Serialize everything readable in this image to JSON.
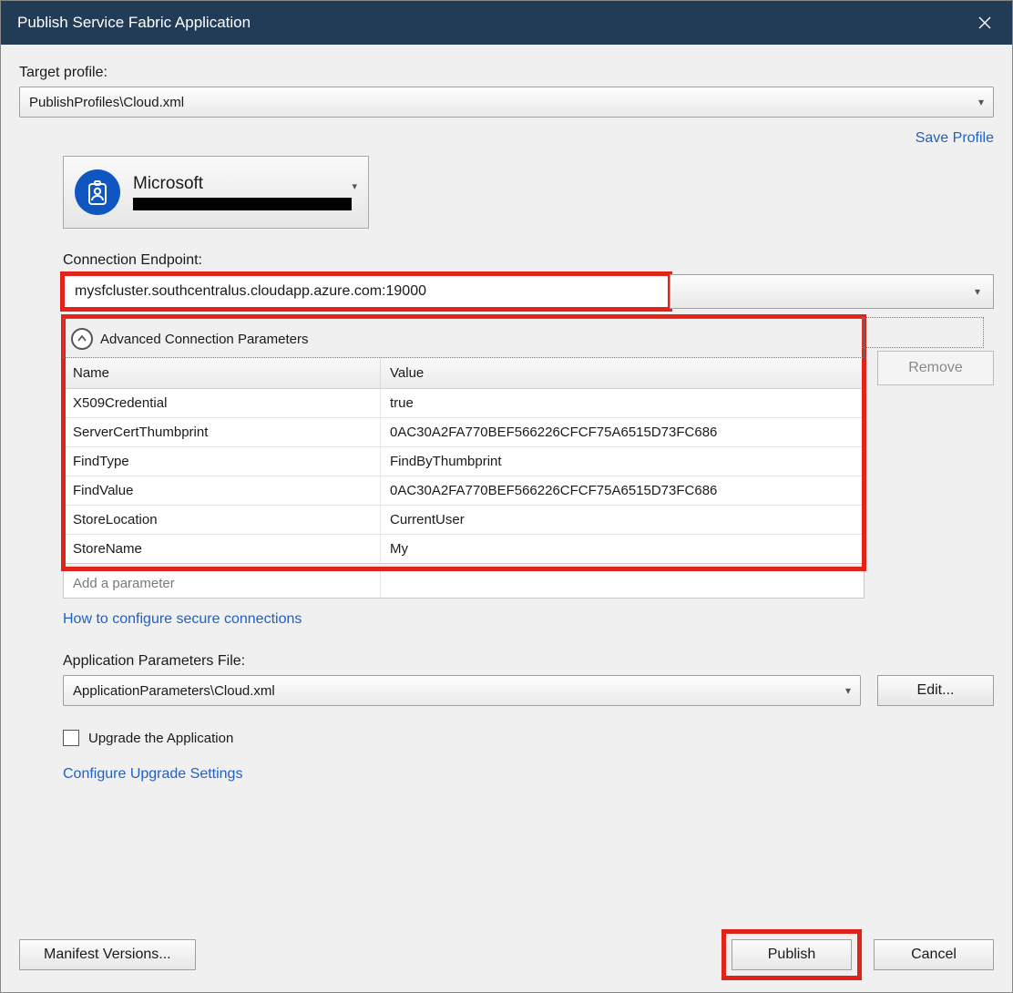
{
  "titlebar": {
    "title": "Publish Service Fabric Application"
  },
  "target_profile": {
    "label": "Target profile:",
    "value": "PublishProfiles\\Cloud.xml"
  },
  "save_profile_label": "Save Profile",
  "account": {
    "name": "Microsoft"
  },
  "connection": {
    "label": "Connection Endpoint:",
    "value": "mysfcluster.southcentralus.cloudapp.azure.com:19000"
  },
  "advanced": {
    "header": "Advanced Connection Parameters",
    "columns": {
      "name": "Name",
      "value": "Value"
    },
    "rows": [
      {
        "name": "X509Credential",
        "value": "true"
      },
      {
        "name": "ServerCertThumbprint",
        "value": "0AC30A2FA770BEF566226CFCF75A6515D73FC686"
      },
      {
        "name": "FindType",
        "value": "FindByThumbprint"
      },
      {
        "name": "FindValue",
        "value": "0AC30A2FA770BEF566226CFCF75A6515D73FC686"
      },
      {
        "name": "StoreLocation",
        "value": "CurrentUser"
      },
      {
        "name": "StoreName",
        "value": "My"
      }
    ],
    "add_placeholder": "Add a parameter",
    "remove_label": "Remove"
  },
  "howto_label": "How to configure secure connections",
  "app_params": {
    "label": "Application Parameters File:",
    "value": "ApplicationParameters\\Cloud.xml",
    "edit_label": "Edit..."
  },
  "upgrade": {
    "checkbox_label": "Upgrade the Application",
    "configure_label": "Configure Upgrade Settings"
  },
  "footer": {
    "manifest_label": "Manifest Versions...",
    "publish_label": "Publish",
    "cancel_label": "Cancel"
  }
}
